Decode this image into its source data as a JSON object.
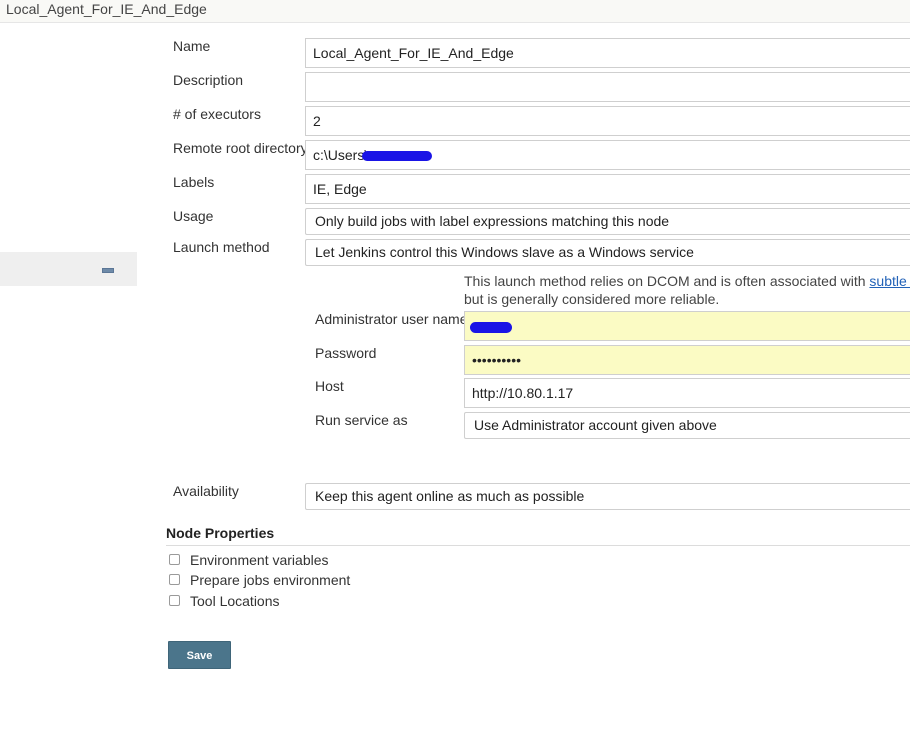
{
  "header": {
    "title": "Local_Agent_For_IE_And_Edge"
  },
  "form": {
    "name": {
      "label": "Name",
      "value": "Local_Agent_For_IE_And_Edge"
    },
    "description": {
      "label": "Description",
      "value": ""
    },
    "executors": {
      "label": "# of executors",
      "value": "2"
    },
    "remote_root": {
      "label": "Remote root directory",
      "value_prefix": "c:\\Users\\"
    },
    "labels": {
      "label": "Labels",
      "value": "IE, Edge"
    },
    "usage": {
      "label": "Usage",
      "selected": "Only build jobs with label expressions matching this node"
    },
    "launch_method": {
      "label": "Launch method",
      "selected": "Let Jenkins control this Windows slave as a Windows service"
    },
    "launch_help": {
      "line1_text": "This launch method relies on DCOM and is often associated with ",
      "line1_link": "subtle pro",
      "line2_text": "but is generally considered more reliable."
    },
    "admin_user": {
      "label": "Administrator user name",
      "value": ""
    },
    "password": {
      "label": "Password",
      "value": "••••••••••"
    },
    "host": {
      "label": "Host",
      "value": "http://10.80.1.17"
    },
    "run_service_as": {
      "label": "Run service as",
      "selected": "Use Administrator account given above"
    },
    "availability": {
      "label": "Availability",
      "selected": "Keep this agent online as much as possible"
    }
  },
  "node_properties": {
    "title": "Node Properties",
    "items": [
      {
        "label": "Environment variables",
        "checked": false
      },
      {
        "label": "Prepare jobs environment",
        "checked": false
      },
      {
        "label": "Tool Locations",
        "checked": false
      }
    ]
  },
  "actions": {
    "save_label": "Save"
  },
  "colors": {
    "save_button": "#4b758b",
    "autofill_yellow": "#fbfbc4",
    "link": "#2262b8",
    "redaction": "#1a14e6"
  }
}
